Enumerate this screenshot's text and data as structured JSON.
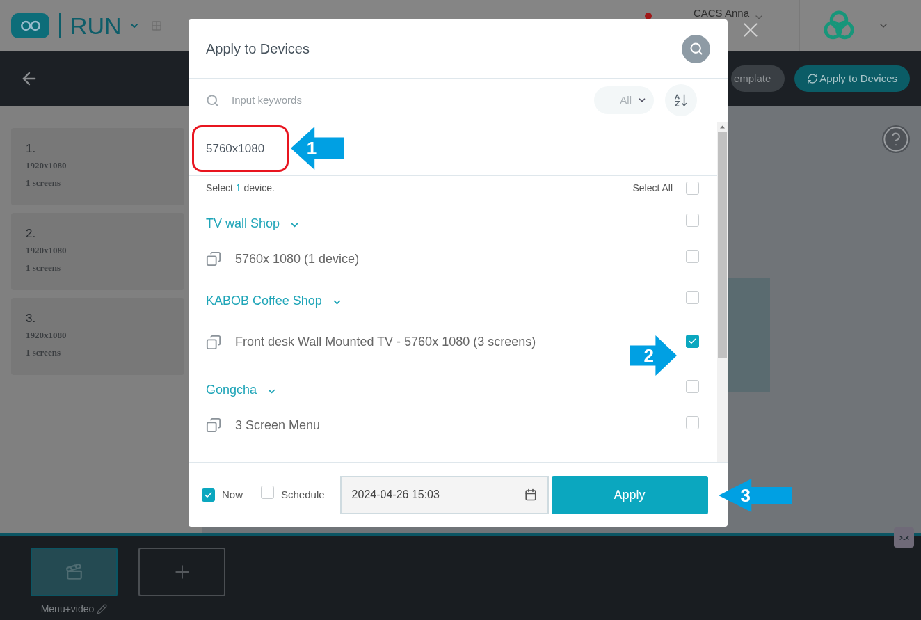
{
  "app_bar": {
    "logo_text": "RUN",
    "user": "CACS Anna"
  },
  "toolbar": {
    "buttons": [
      {
        "kind": "template",
        "label": "emplate"
      },
      {
        "kind": "apply",
        "label": "Apply to Devices"
      }
    ]
  },
  "layouts": [
    {
      "number": "1.",
      "resolution": "1920x1080",
      "screens": "1 screens"
    },
    {
      "number": "2.",
      "resolution": "1920x1080",
      "screens": "1 screens"
    },
    {
      "number": "3.",
      "resolution": "1920x1080",
      "screens": "1 screens"
    }
  ],
  "scenes": [
    {
      "label": "Menu+video",
      "selected": true
    }
  ],
  "dialog": {
    "title": "Apply to Devices",
    "search": {
      "placeholder": "Input keywords"
    },
    "filter": "All",
    "resolution": "5760x1080",
    "summary": {
      "prefix": "Select",
      "count": "1",
      "suffix": "device."
    },
    "select_all": {
      "label": "Select All",
      "checked": false
    },
    "groups": [
      {
        "name": "TV wall Shop",
        "expanded": true,
        "checked": false,
        "children": [
          {
            "name": "5760x 1080 (1 device)",
            "checked": false
          }
        ]
      },
      {
        "name": "KABOB Coffee Shop",
        "expanded": true,
        "checked": false,
        "children": [
          {
            "name": "Front desk Wall Mounted TV - 5760x 1080 (3 screens)",
            "checked": true
          }
        ]
      },
      {
        "name": "Gongcha",
        "expanded": true,
        "checked": false,
        "children": [
          {
            "name": "3 Screen Menu",
            "checked": false
          }
        ]
      }
    ],
    "now": {
      "label": "Now",
      "checked": true
    },
    "schedule": {
      "label": "Schedule",
      "checked": false
    },
    "datetime": "2024-04-26 15:03",
    "apply": "Apply"
  },
  "annotations": [
    {
      "label": "1"
    },
    {
      "label": "2"
    },
    {
      "label": "3"
    }
  ]
}
